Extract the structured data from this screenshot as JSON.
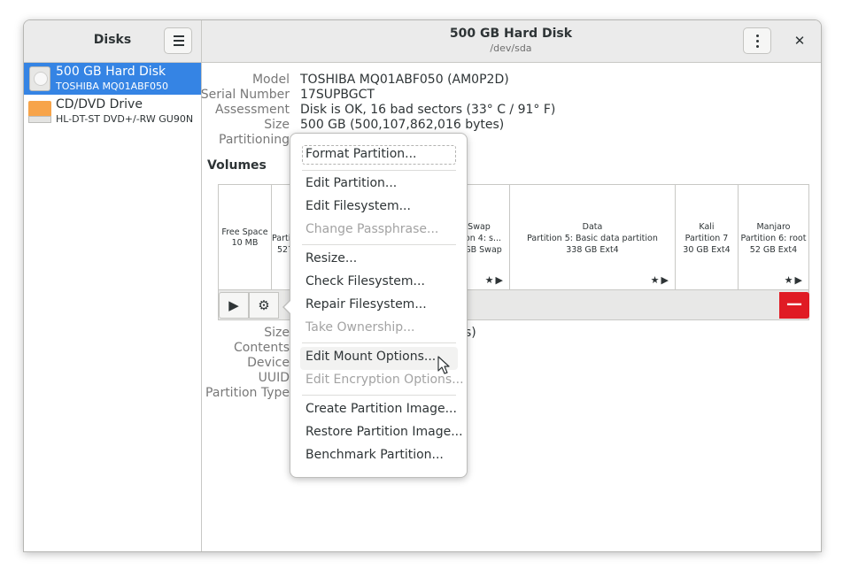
{
  "sidebar": {
    "title": "Disks",
    "drives": [
      {
        "name": "500 GB Hard Disk",
        "model": "TOSHIBA MQ01ABF050",
        "icon": "hard-disk-icon"
      },
      {
        "name": "CD/DVD Drive",
        "model": "HL-DT-ST DVD+/-RW GU90N",
        "icon": "optical-drive-icon"
      }
    ]
  },
  "header": {
    "title": "500 GB Hard Disk",
    "subtitle": "/dev/sda",
    "menu_icon": "hamburger-icon",
    "kebab_icon": "vertical-dots-icon",
    "close_label": "✕"
  },
  "disk_info": {
    "model_label": "Model",
    "model_value": "TOSHIBA MQ01ABF050 (AM0P2D)",
    "serial_label": "Serial Number",
    "serial_value": "17SUPBGCT",
    "assessment_label": "Assessment",
    "assessment_value": "Disk is OK, 16 bad sectors (33° C / 91° F)",
    "size_label": "Size",
    "size_value": "500 GB (500,107,862,016 bytes)",
    "partitioning_label": "Partitioning"
  },
  "volumes": {
    "heading": "Volumes",
    "segments": [
      {
        "l1": "Free Space",
        "l2": "10 MB",
        "l3": "",
        "stars": ""
      },
      {
        "l1": "Parti",
        "l2": "527",
        "l3": "",
        "stars": ""
      },
      {
        "l1": "Swap",
        "l2": "ition 4: s...",
        "l3": "0 GB Swap",
        "stars": "★▶"
      },
      {
        "l1": "Data",
        "l2": "Partition 5: Basic data partition",
        "l3": "338 GB Ext4",
        "stars": "★▶"
      },
      {
        "l1": "Kali",
        "l2": "Partition 7",
        "l3": "30 GB Ext4",
        "stars": ""
      },
      {
        "l1": "Manjaro",
        "l2": "Partition 6: root",
        "l3": "52 GB Ext4",
        "stars": "★▶"
      }
    ],
    "play_icon": "▶",
    "settings_icon": "⚙",
    "delete_icon": "—"
  },
  "partition_info": {
    "size_label": "Size",
    "size_value_tail": "s)",
    "contents_label": "Contents",
    "device_label": "Device",
    "uuid_label": "UUID",
    "type_label": "Partition Type"
  },
  "context_menu": {
    "items": [
      {
        "label": "Format Partition...",
        "enabled": true
      },
      {
        "label": "Edit Partition...",
        "enabled": true
      },
      {
        "label": "Edit Filesystem...",
        "enabled": true
      },
      {
        "label": "Change Passphrase...",
        "enabled": false
      },
      {
        "label": "Resize...",
        "enabled": true
      },
      {
        "label": "Check Filesystem...",
        "enabled": true
      },
      {
        "label": "Repair Filesystem...",
        "enabled": true
      },
      {
        "label": "Take Ownership...",
        "enabled": false
      },
      {
        "label": "Edit Mount Options...",
        "enabled": true
      },
      {
        "label": "Edit Encryption Options...",
        "enabled": false
      },
      {
        "label": "Create Partition Image...",
        "enabled": true
      },
      {
        "label": "Restore Partition Image...",
        "enabled": true
      },
      {
        "label": "Benchmark Partition...",
        "enabled": true
      }
    ]
  },
  "colors": {
    "selection": "#3584e4",
    "destructive": "#e01b24",
    "optical_drive": "#f7a44a"
  }
}
